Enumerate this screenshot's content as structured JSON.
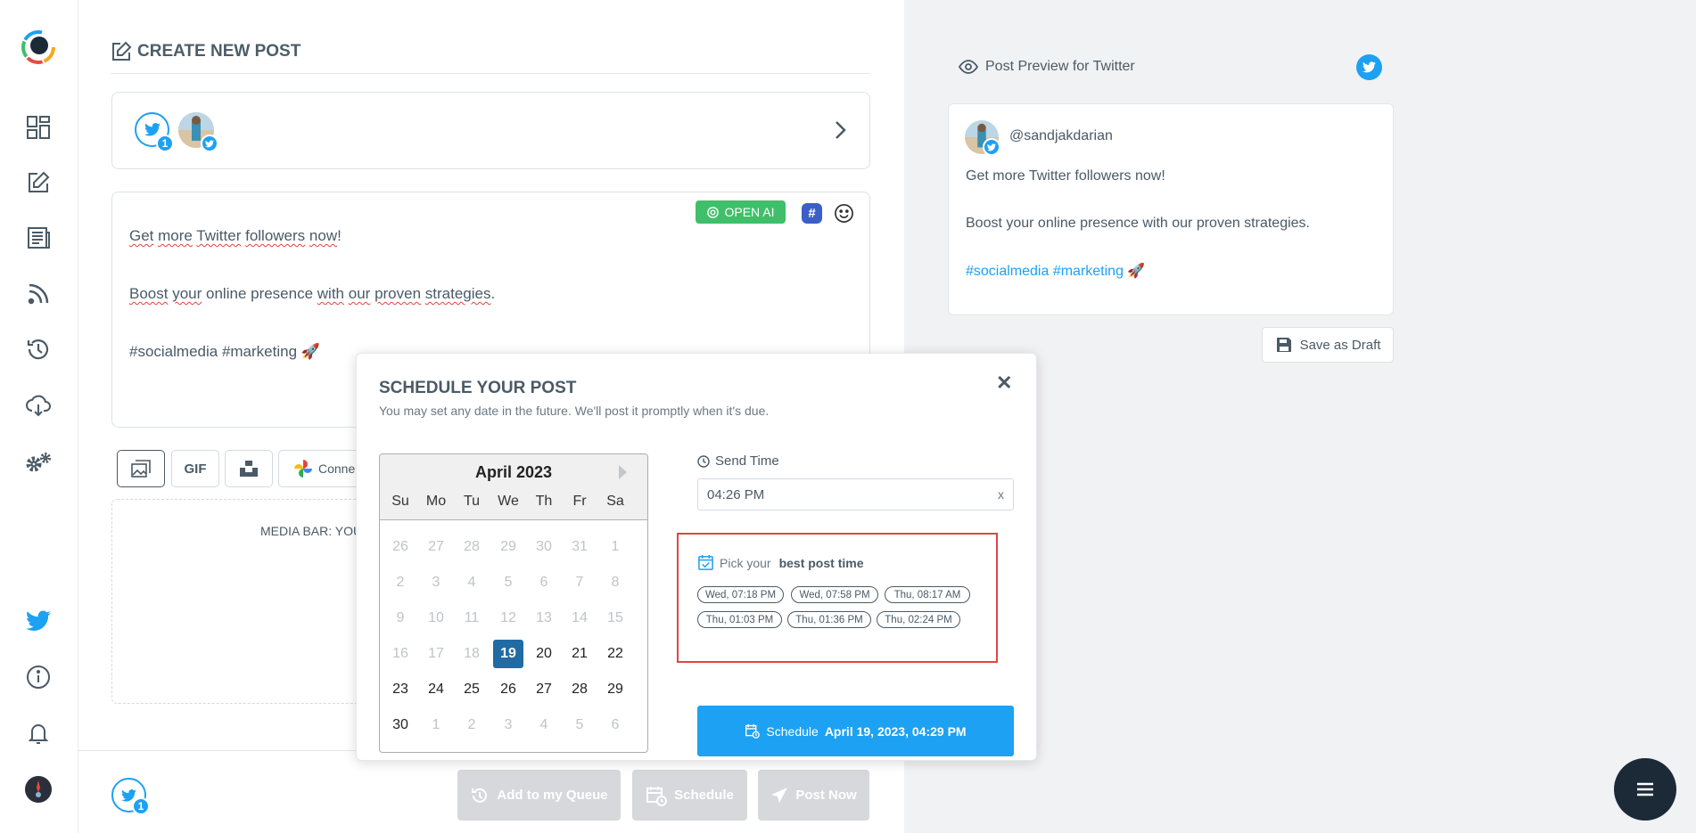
{
  "sidebar": {
    "icons": [
      "dashboard-icon",
      "edit-icon",
      "newspaper-icon",
      "rss-icon",
      "history-icon",
      "cloud-download-icon",
      "settings-icon",
      "twitter-icon",
      "info-icon",
      "bell-icon"
    ],
    "brand_color": "#1da1f2"
  },
  "header": {
    "title": "CREATE NEW POST"
  },
  "accounts": {
    "badge_count": "1"
  },
  "editor": {
    "openai_label": "OPEN AI",
    "hash_label": "#",
    "line1": [
      "Get",
      " ",
      "more",
      " ",
      "Twitter",
      " ",
      "followers",
      " ",
      "now",
      "!"
    ],
    "line2": [
      "Boost",
      " ",
      "your",
      " online presence ",
      "with",
      " ",
      "our",
      " ",
      "proven",
      " ",
      "strategies",
      "."
    ],
    "line3": "#socialmedia #marketing 🚀"
  },
  "media": {
    "gif_label": "GIF",
    "connect_label": "Conne",
    "bar_label": "MEDIA BAR: YOU"
  },
  "footer": {
    "badge_count": "1",
    "queue_label": "Add to my Queue",
    "schedule_label": "Schedule",
    "postnow_label": "Post Now"
  },
  "preview": {
    "heading": "Post Preview for Twitter",
    "username": "@sandjakdarian",
    "line1": "Get more Twitter followers now!",
    "line2": "Boost your online presence with our proven strategies.",
    "line3": "#socialmedia #marketing 🚀",
    "hashtag_color": "#1da1f2",
    "save_draft_label": "Save as Draft"
  },
  "modal": {
    "title": "SCHEDULE YOUR POST",
    "subtitle": "You may set any date in the future. We'll post it promptly when it's due.",
    "close": "✕",
    "calendar": {
      "month": "April 2023",
      "weekdays": [
        "Su",
        "Mo",
        "Tu",
        "We",
        "Th",
        "Fr",
        "Sa"
      ],
      "weeks": [
        [
          "26",
          "27",
          "28",
          "29",
          "30",
          "31",
          "1"
        ],
        [
          "2",
          "3",
          "4",
          "5",
          "6",
          "7",
          "8"
        ],
        [
          "9",
          "10",
          "11",
          "12",
          "13",
          "14",
          "15"
        ],
        [
          "16",
          "17",
          "18",
          "19",
          "20",
          "21",
          "22"
        ],
        [
          "23",
          "24",
          "25",
          "26",
          "27",
          "28",
          "29"
        ],
        [
          "30",
          "1",
          "2",
          "3",
          "4",
          "5",
          "6"
        ]
      ],
      "selected": "19"
    },
    "send_time_label": "Send Time",
    "send_time_value": "04:26 PM",
    "clear": "x",
    "best_prefix": "Pick your",
    "best_bold": "best post time",
    "best_times": [
      "Wed, 07:18 PM",
      "Wed, 07:58 PM",
      "Thu, 08:17 AM",
      "Thu, 01:03 PM",
      "Thu, 01:36 PM",
      "Thu, 02:24 PM"
    ],
    "schedule_word": "Schedule",
    "schedule_when": "April 19, 2023, 04:29 PM",
    "highlight_color": "#e54345"
  }
}
